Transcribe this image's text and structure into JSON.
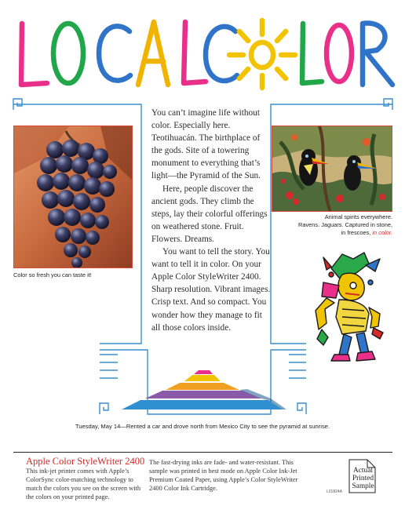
{
  "headline": {
    "text": "LOCAL COLOR",
    "letter_colors": [
      "#e8308a",
      "#22a64a",
      "#2f74c8",
      "#f0b400",
      "#e8308a",
      "#2f74c8",
      "#f2c300",
      "#22a64a",
      "#e8308a",
      "#2f74c8"
    ]
  },
  "body_paragraphs": [
    "You can’t imagine life without color. Especially here. Teotihuacán. The birthplace of the gods. Site of a towering monument to everything that’s light—the Pyramid of the Sun.",
    "Here, people discover the ancient gods. They climb the steps, lay their colorful offerings on weathered stone. Fruit. Flowers. Dreams.",
    "You want to tell the story. You want to tell it in color. On your Apple Color StyleWriter 2400. Sharp resolution. Vibrant images. Crisp text. And so compact. You wonder how they manage to fit all those colors inside."
  ],
  "captions": {
    "grapes": "Color so fresh you can taste it!",
    "birds_line1": "Animal spirits everywhere.",
    "birds_line2": "Ravens. Jaguars. Captured in stone,",
    "birds_line3": "in frescoes,",
    "birds_red": "in color."
  },
  "date_caption": "Tuesday, May 14—Rented a car and drove north from Mexico City to see the pyramid at sunrise.",
  "footer": {
    "product_name": "Apple Color StyleWriter 2400",
    "description_left": "This ink-jet printer comes with Apple’s ColorSync color-matching technology to match the colors you see on the screen with the colors on your printed page.",
    "description_right": "The fast-drying inks are fade- and water-resistant. This sample was printed in best mode on Apple Color Ink-Jet Premium Coated Paper, using Apple’s Color StyleWriter 2400 Color Ink Cartridge.",
    "code": "L01824A",
    "badge_line1": "Actual",
    "badge_line2": "Printed",
    "badge_line3": "Sample"
  },
  "colors": {
    "accent_red": "#d42a2a",
    "frame_blue": "#3a8fd0"
  }
}
